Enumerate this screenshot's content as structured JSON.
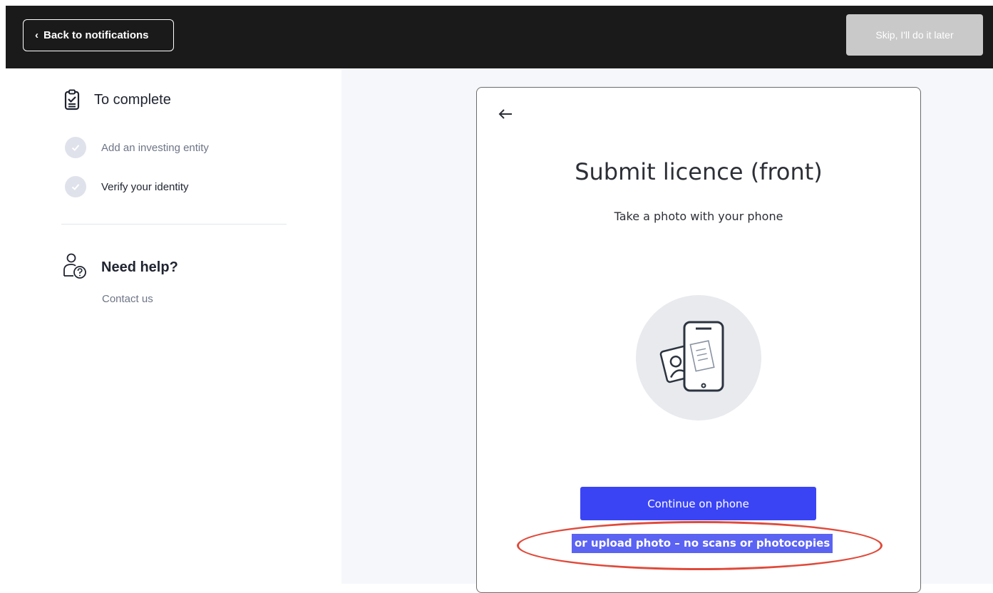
{
  "header": {
    "back_label": "Back to notifications",
    "skip_label": "Skip, I'll do it later"
  },
  "sidebar": {
    "todo_title": "To complete",
    "steps": [
      {
        "label": "Add an investing entity",
        "state": "done"
      },
      {
        "label": "Verify your identity",
        "state": "current"
      }
    ],
    "help_title": "Need help?",
    "contact_label": "Contact us"
  },
  "card": {
    "title": "Submit licence (front)",
    "subtitle": "Take a photo with your phone",
    "continue_label": "Continue on phone",
    "upload_label": "or upload photo – no scans or photocopies"
  },
  "colors": {
    "topbar": "#1a1a1a",
    "primary": "#3a44f5",
    "annotation": "#e04a3a"
  },
  "icons": [
    "chevron-left-icon",
    "clipboard-check-icon",
    "check-icon",
    "help-person-icon",
    "arrow-left-icon",
    "phone-id-illustration"
  ]
}
